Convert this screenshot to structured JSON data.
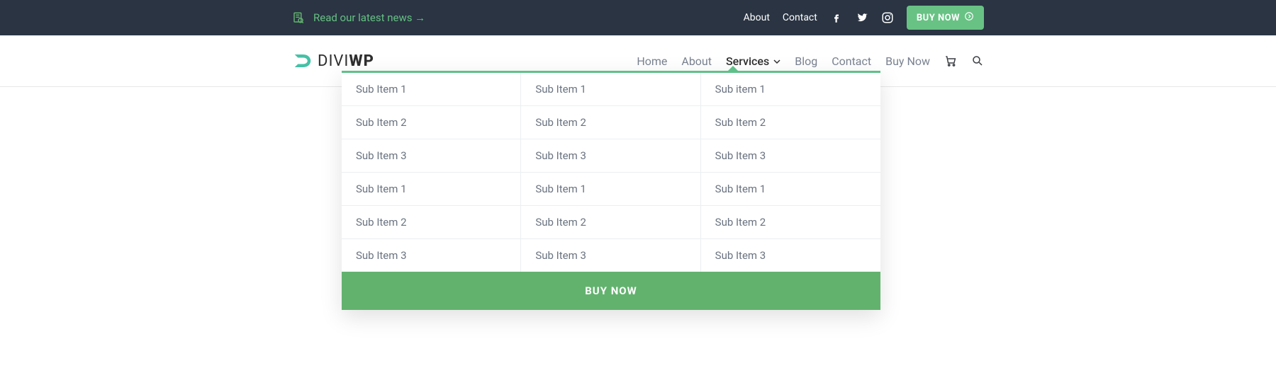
{
  "topbar": {
    "news_label": "Read our latest news →",
    "links": {
      "about": "About",
      "contact": "Contact"
    },
    "buy_label": "BUY NOW"
  },
  "logo": {
    "part1": "DIVI",
    "part2": "WP"
  },
  "nav": {
    "home": "Home",
    "about": "About",
    "services": "Services",
    "blog": "Blog",
    "contact": "Contact",
    "buy": "Buy Now"
  },
  "mega": {
    "columns": [
      [
        "Sub Item 1",
        "Sub Item 2",
        "Sub Item 3",
        "Sub Item 1",
        "Sub Item 2",
        "Sub Item 3"
      ],
      [
        "Sub Item 1",
        "Sub Item 2",
        "Sub Item 3",
        "Sub Item 1",
        "Sub Item 2",
        "Sub Item 3"
      ],
      [
        "Sub item 1",
        "Sub Item 2",
        "Sub Item 3",
        "Sub Item 1",
        "Sub Item 2",
        "Sub Item 3"
      ]
    ],
    "cta_label": "BUY NOW"
  }
}
